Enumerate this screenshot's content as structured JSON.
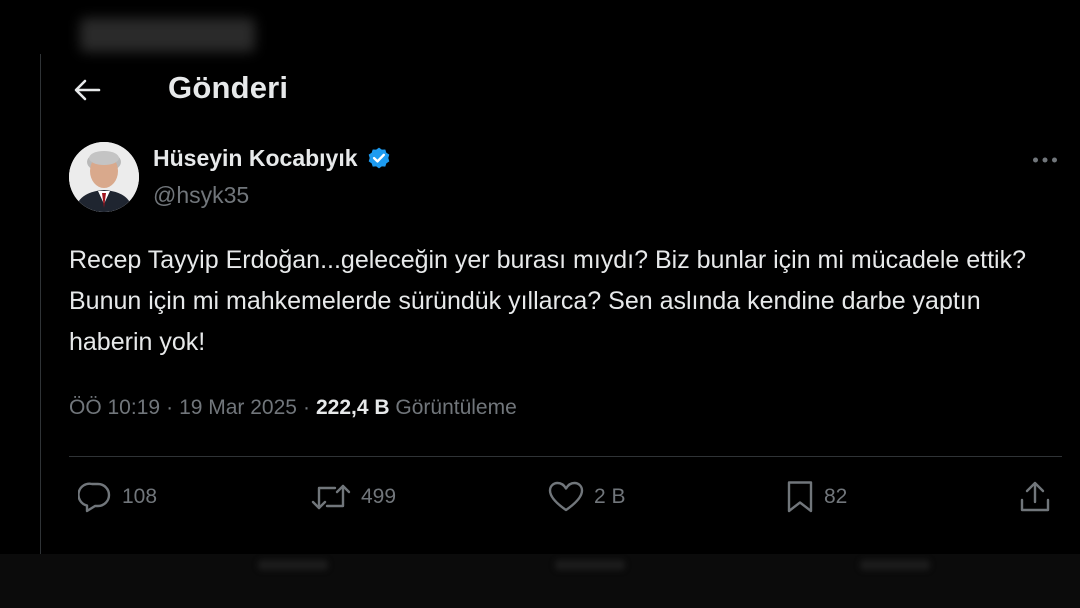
{
  "header": {
    "title": "Gönderi"
  },
  "author": {
    "name": "Hüseyin Kocabıyık",
    "handle": "@hsyk35",
    "verified": true,
    "verified_color": "#1d9bf0"
  },
  "tweet": {
    "text": "Recep Tayyip Erdoğan...geleceğin yer burası mıydı? Biz bunlar için mi mücadele ettik? Bunun için mi mahkemelerde süründük yıllarca? Sen aslında kendine darbe yaptın haberin yok!"
  },
  "meta": {
    "time": "ÖÖ 10:19",
    "separator": "·",
    "date": "19 Mar 2025",
    "views_count": "222,4 B",
    "views_label": "Görüntüleme"
  },
  "actions": {
    "replies": "108",
    "reposts": "499",
    "likes": "2 B",
    "bookmarks": "82"
  },
  "icons": {
    "back": "arrow-left-icon",
    "more": "more-horizontal-icon",
    "reply": "reply-icon",
    "repost": "repost-icon",
    "like": "heart-icon",
    "bookmark": "bookmark-icon",
    "share": "share-icon"
  },
  "colors": {
    "background": "#000000",
    "text_primary": "#e7e9ea",
    "text_secondary": "#71767b",
    "divider": "#2f3336"
  }
}
